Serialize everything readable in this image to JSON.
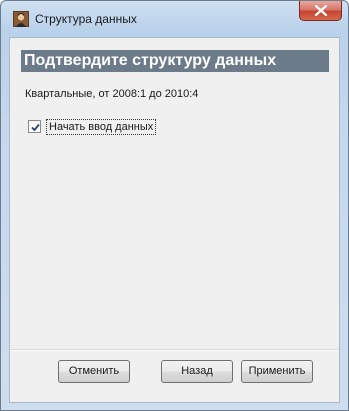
{
  "window": {
    "title": "Структура данных",
    "app_icon": "app-portrait-icon",
    "close_icon": "close-icon"
  },
  "content": {
    "heading": "Подтвердите структуру данных",
    "subtitle": "Квартальные, от 2008:1 до 2010:4",
    "start_entry_checkbox": {
      "label": "Начать ввод данных",
      "checked": true
    }
  },
  "buttons": {
    "cancel": "Отменить",
    "back": "Назад",
    "apply": "Применить"
  },
  "colors": {
    "heading_bg": "#6b7b89",
    "close_button": "#c6432f",
    "frame": "#b9d1ea"
  }
}
